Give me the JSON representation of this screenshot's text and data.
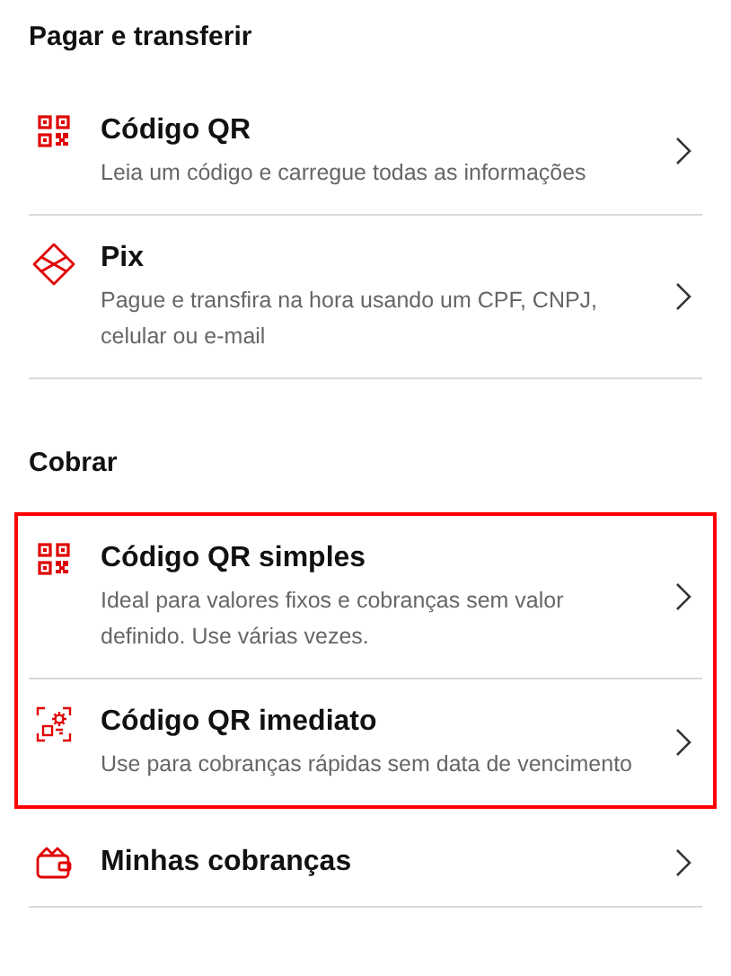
{
  "sections": [
    {
      "title": "Pagar e transferir",
      "items": [
        {
          "kind": "qr",
          "title": "Código QR",
          "description": "Leia um código e carregue todas as informações",
          "highlighted": false
        },
        {
          "kind": "pix",
          "title": "Pix",
          "description": "Pague e transfira na hora usando um CPF, CNPJ, celular ou e-mail",
          "highlighted": false
        }
      ]
    },
    {
      "title": "Cobrar",
      "items": [
        {
          "kind": "qr",
          "title": "Código QR simples",
          "description": "Ideal para valores fixos e cobranças sem valor definido. Use várias vezes.",
          "highlighted": true
        },
        {
          "kind": "qr-gear",
          "title": "Código QR imediato",
          "description": "Use para cobranças rápidas sem data de vencimento",
          "highlighted": true
        },
        {
          "kind": "wallet",
          "title": "Minhas cobranças",
          "highlighted": false
        }
      ]
    }
  ]
}
